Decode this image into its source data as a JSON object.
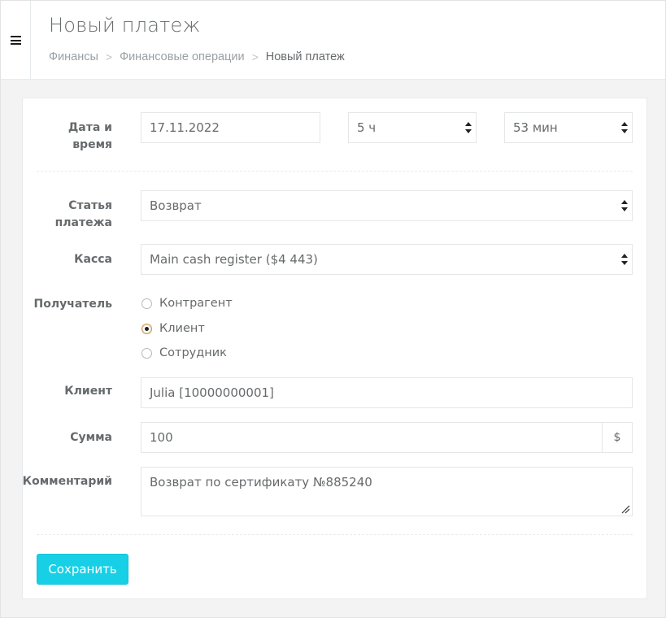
{
  "header": {
    "title": "Новый платеж",
    "breadcrumb": [
      "Финансы",
      "Финансовые операции",
      "Новый платеж"
    ],
    "breadcrumb_separator": ">"
  },
  "form": {
    "datetime": {
      "label_line1": "Дата и",
      "label_line2": "время",
      "date_value": "17.11.2022",
      "hour_value": "5 ч",
      "minute_value": "53 мин"
    },
    "article": {
      "label_line1": "Статья",
      "label_line2": "платежа",
      "value": "Возврат"
    },
    "cashbox": {
      "label": "Касса",
      "value": "Main cash register ($4 443)"
    },
    "recipient": {
      "label": "Получатель",
      "options": [
        {
          "label": "Контрагент",
          "checked": false
        },
        {
          "label": "Клиент",
          "checked": true
        },
        {
          "label": "Сотрудник",
          "checked": false
        }
      ]
    },
    "client": {
      "label": "Клиент",
      "value": "Julia [10000000001]"
    },
    "amount": {
      "label": "Сумма",
      "value": "100",
      "currency": "$"
    },
    "comment": {
      "label": "Комментарий",
      "value": "Возврат по сертификату №885240"
    },
    "save_label": "Сохранить"
  },
  "colors": {
    "primary_button": "#17d0e6",
    "text": "#676a6c",
    "radio_checked_border": "#c59553"
  },
  "icons": {
    "menu": "hamburger-icon",
    "select": "select-arrows-icon",
    "resize": "resize-handle-icon"
  }
}
